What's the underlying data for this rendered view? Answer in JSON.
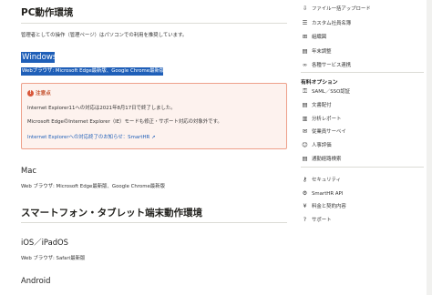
{
  "main": {
    "pc_heading": "PC動作環境",
    "pc_desc": "管理者としての操作（管理ページ）はパソコンでの利用を推奨しています。",
    "windows_heading": "Windows",
    "windows_browsers": "Webブラウザ: Microsoft Edge最新版、Google Chrome最新版",
    "notice": {
      "title": "注意点",
      "line1": "Internet Explorer11への対応は2021年8月17日で終了しました。",
      "line2": "Microsoft EdgeのInternet Explorer（IE）モードも修正・サポート対応の対象外です。",
      "link": "Internet Explorerへの対応終了のお知らせ：SmartHR"
    },
    "mac_heading": "Mac",
    "mac_browsers": "Web ブラウザ: Microsoft Edge最新版、Google Chrome最新版",
    "mobile_heading": "スマートフォン・タブレット端末動作環境",
    "ios_heading": "iOS／iPadOS",
    "ios_browsers": "Web ブラウザ: Safari最新版",
    "android_heading": "Android"
  },
  "sidebar": {
    "top_items": [
      {
        "icon": "download-icon",
        "label": "ファイル一括アップロード"
      },
      {
        "icon": "list-icon",
        "label": "カスタム社員名簿"
      },
      {
        "icon": "org-chart-icon",
        "label": "組織図"
      },
      {
        "icon": "document-icon",
        "label": "年末調整"
      },
      {
        "icon": "link-icon",
        "label": "各種サービス連携"
      }
    ],
    "options_heading": "有料オプション",
    "option_items": [
      {
        "icon": "key-icon",
        "label": "SAML／SSO認証"
      },
      {
        "icon": "document-icon",
        "label": "文書配付"
      },
      {
        "icon": "chart-icon",
        "label": "分析レポート"
      },
      {
        "icon": "survey-icon",
        "label": "従業員サーベイ"
      },
      {
        "icon": "person-icon",
        "label": "人事評価"
      },
      {
        "icon": "document-icon",
        "label": "通勤経路検索"
      }
    ],
    "bottom_items": [
      {
        "icon": "lock-icon",
        "label": "セキュリティ"
      },
      {
        "icon": "api-icon",
        "label": "SmartHR API"
      },
      {
        "icon": "yen-icon",
        "label": "料金と契約内容"
      },
      {
        "icon": "help-icon",
        "label": "サポート"
      }
    ]
  }
}
